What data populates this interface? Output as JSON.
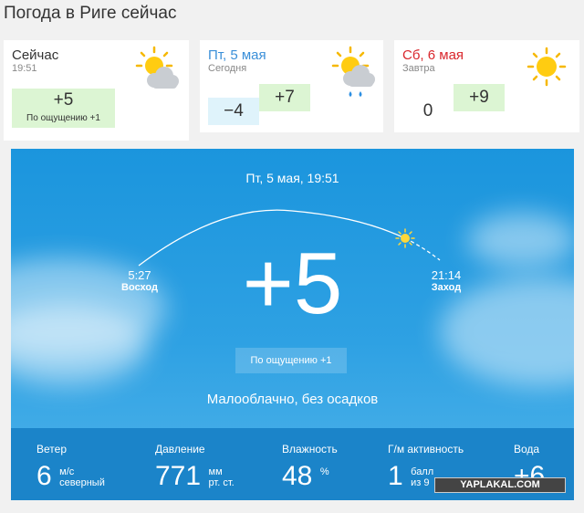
{
  "page_title": "Погода в Риге сейчас",
  "now": {
    "label": "Сейчас",
    "time": "19:51",
    "temp": "+5",
    "feels": "По ощущению +1",
    "icon": "sun-cloud-icon"
  },
  "friday": {
    "day": "Пт, 5 мая",
    "sub": "Сегодня",
    "min": "−4",
    "max": "+7",
    "icon": "sun-cloud-rain-icon",
    "day_color": "#3a8fd8"
  },
  "saturday": {
    "day": "Сб, 6 мая",
    "sub": "Завтра",
    "min": "0",
    "max": "+9",
    "icon": "sun-icon",
    "day_color": "#d9262c"
  },
  "main": {
    "datetime": "Пт, 5 мая, 19:51",
    "sunrise_time": "5:27",
    "sunrise_label": "Восход",
    "sunset_time": "21:14",
    "sunset_label": "Заход",
    "temp": "+5",
    "feels": "По ощущению +1",
    "condition": "Малооблачно, без осадков"
  },
  "stats": {
    "wind": {
      "label": "Ветер",
      "value": "6",
      "unit1": "м/с",
      "unit2": "северный"
    },
    "pressure": {
      "label": "Давление",
      "value": "771",
      "unit1": "мм",
      "unit2": "рт. ст."
    },
    "humidity": {
      "label": "Влажность",
      "value": "48",
      "unit1": "%"
    },
    "geomagnetic": {
      "label": "Г/м активность",
      "value": "1",
      "unit1": "балл",
      "unit2": "из 9"
    },
    "water": {
      "label": "Вода",
      "value": "+6"
    }
  },
  "watermark": "YAPLAKAL.COM"
}
